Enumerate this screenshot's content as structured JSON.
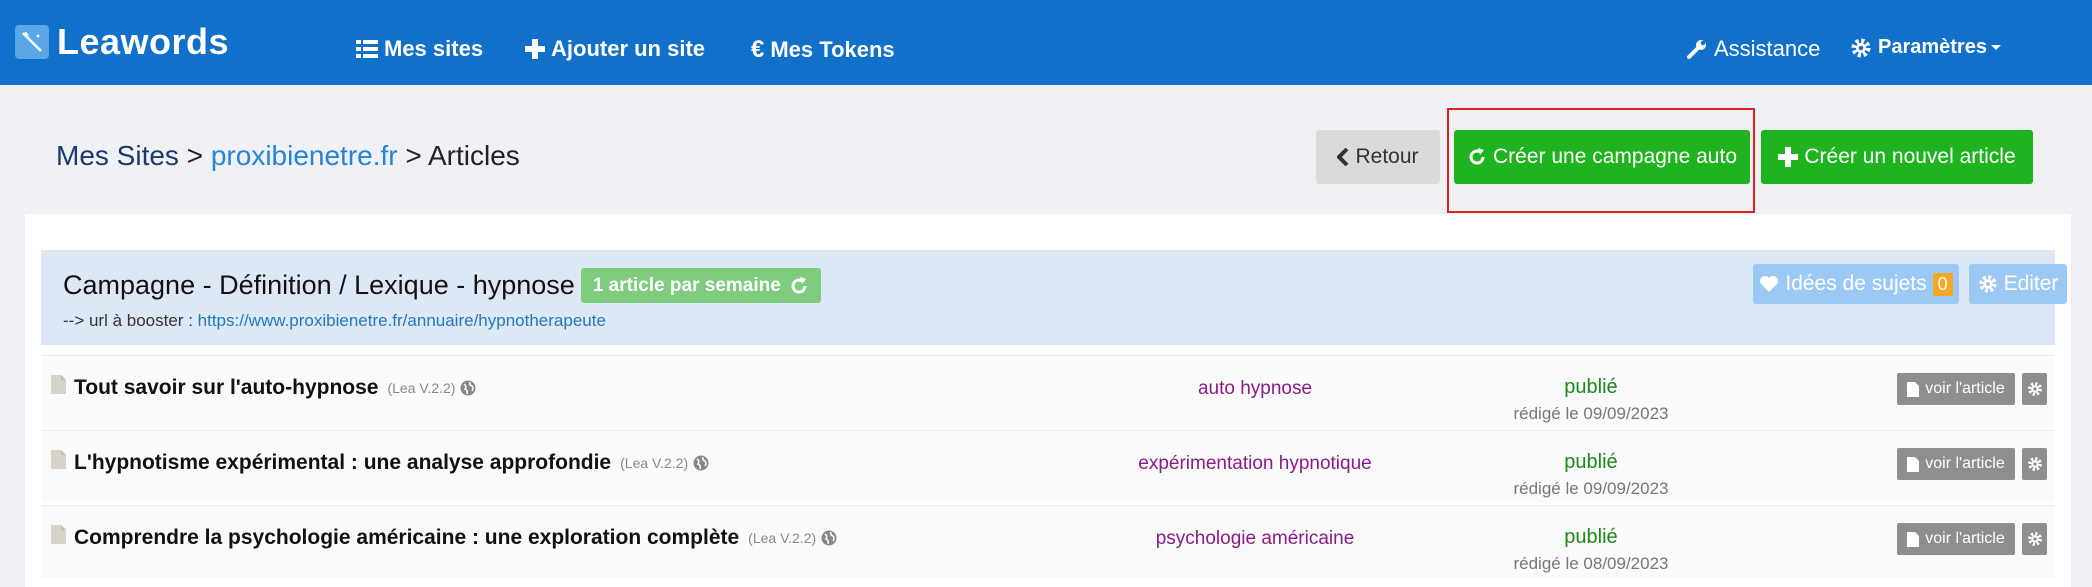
{
  "navbar": {
    "brand": "Leawords",
    "items": [
      {
        "label": "Mes sites",
        "icon": "list-icon"
      },
      {
        "label": "Ajouter un site",
        "icon": "plus-icon"
      },
      {
        "label": "Mes Tokens",
        "icon": "euro-icon"
      }
    ],
    "assistance": {
      "label": "Assistance",
      "icon": "wrench-icon"
    },
    "settings": {
      "label": "Paramètres",
      "icon": "gear-icon"
    }
  },
  "breadcrumb": {
    "root": "Mes Sites",
    "sep1": ">",
    "site": "proxibienetre.fr",
    "sep2": ">",
    "current": "Articles"
  },
  "actions": {
    "back": "Retour",
    "create_campaign": "Créer une campagne auto",
    "create_article": "Créer un nouvel article"
  },
  "campaign": {
    "title": "Campagne - Définition / Lexique - hypnose",
    "frequency": "1 article par semaine",
    "url_prefix": "--> url à booster :",
    "url": "https://www.proxibienetre.fr/annuaire/hypnotherapeute",
    "ideas_label": "Idées de sujets",
    "ideas_count": "0",
    "edit_label": "Editer"
  },
  "articles": [
    {
      "title": "Tout savoir sur l'auto-hypnose",
      "version": "(Lea V.2.2)",
      "keyword": "auto hypnose",
      "status": "publié",
      "date": "rédigé le 09/09/2023",
      "view": "voir l'article"
    },
    {
      "title": "L'hypnotisme expérimental : une analyse approfondie",
      "version": "(Lea V.2.2)",
      "keyword": "expérimentation hypnotique",
      "status": "publié",
      "date": "rédigé le 09/09/2023",
      "view": "voir l'article"
    },
    {
      "title": "Comprendre la psychologie américaine : une exploration complète",
      "version": "(Lea V.2.2)",
      "keyword": "psychologie américaine",
      "status": "publié",
      "date": "rédigé le 08/09/2023",
      "view": "voir l'article"
    }
  ],
  "colors": {
    "navbar": "#1170c9",
    "green": "#1fb31f",
    "highlight": "#e02020",
    "keyword": "#8b1a8b",
    "status": "#1a8a1a"
  }
}
